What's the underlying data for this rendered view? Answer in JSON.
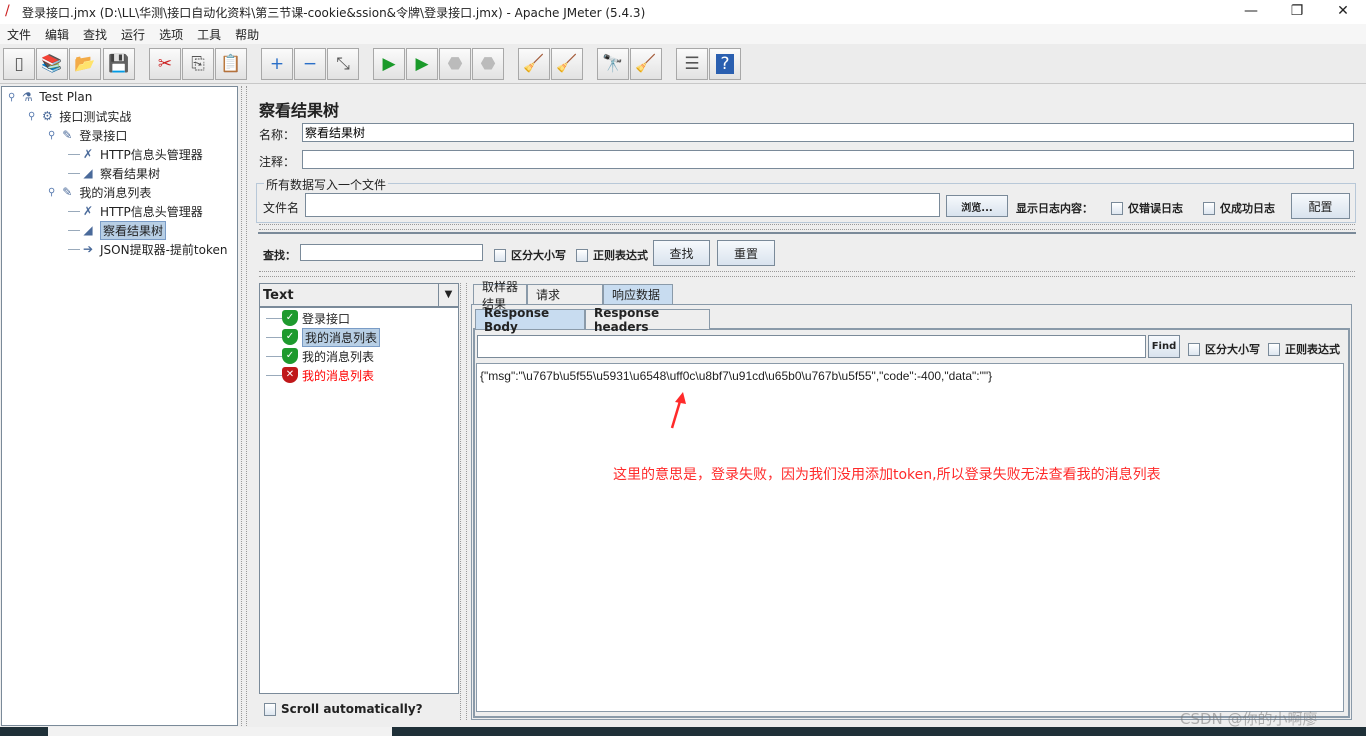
{
  "window": {
    "title": "登录接口.jmx (D:\\LL\\华测\\接口自动化资料\\第三节课-cookie&ssion&令牌\\登录接口.jmx) - Apache JMeter (5.4.3)",
    "minimize": "—",
    "maximize": "❐",
    "close": "✕"
  },
  "menu": [
    "文件",
    "编辑",
    "查找",
    "运行",
    "选项",
    "工具",
    "帮助"
  ],
  "toolbar": [
    {
      "icon": "new-icon",
      "g": "▯"
    },
    {
      "icon": "templates-icon",
      "g": "📚"
    },
    {
      "icon": "open-icon",
      "g": "📂"
    },
    {
      "icon": "save-icon",
      "g": "💾"
    },
    {
      "icon": "cut-icon",
      "g": "✂"
    },
    {
      "icon": "copy-icon",
      "g": "⎘"
    },
    {
      "icon": "paste-icon",
      "g": "📋"
    },
    {
      "icon": "expand-icon",
      "g": "+"
    },
    {
      "icon": "collapse-icon",
      "g": "−"
    },
    {
      "icon": "toggle-icon",
      "g": "⤡"
    },
    {
      "icon": "start-icon",
      "g": "▶"
    },
    {
      "icon": "start-no-pause-icon",
      "g": "▶"
    },
    {
      "icon": "stop-icon",
      "g": "⬣"
    },
    {
      "icon": "shutdown-icon",
      "g": "⬣"
    },
    {
      "icon": "clear-icon",
      "g": "🧹"
    },
    {
      "icon": "clear-all-icon",
      "g": "🧹"
    },
    {
      "icon": "search-icon",
      "g": "🔭"
    },
    {
      "icon": "reset-search-icon",
      "g": "🧹"
    },
    {
      "icon": "function-helper-icon",
      "g": "☰"
    },
    {
      "icon": "help-icon",
      "g": "?"
    }
  ],
  "tree": [
    {
      "label": "Test Plan",
      "icon": "test-plan-icon",
      "g": "⚗",
      "level": 0
    },
    {
      "label": "接口测试实战",
      "icon": "thread-group-icon",
      "g": "⚙",
      "level": 1
    },
    {
      "label": "登录接口",
      "icon": "sampler-icon",
      "g": "✎",
      "level": 2
    },
    {
      "label": "HTTP信息头管理器",
      "icon": "config-icon",
      "g": "✗",
      "level": 3
    },
    {
      "label": "察看结果树",
      "icon": "listener-icon",
      "g": "◢",
      "level": 3
    },
    {
      "label": "我的消息列表",
      "icon": "sampler-icon",
      "g": "✎",
      "level": 2
    },
    {
      "label": "HTTP信息头管理器",
      "icon": "config-icon",
      "g": "✗",
      "level": 3
    },
    {
      "label": "察看结果树",
      "icon": "listener-icon",
      "g": "◢",
      "level": 3,
      "selected": true
    },
    {
      "label": "JSON提取器-提前token",
      "icon": "extractor-icon",
      "g": "➔",
      "level": 3
    }
  ],
  "main": {
    "title": "察看结果树",
    "name_label": "名称：",
    "name_value": "察看结果树",
    "comment_label": "注释：",
    "comment_value": "",
    "file_group": "所有数据写入一个文件",
    "file_label": "文件名",
    "file_value": "",
    "browse": "浏览...",
    "log_label": "显示日志内容：",
    "errors_only": "仅错误日志",
    "success_only": "仅成功日志",
    "configure": "配置",
    "search_label": "查找：",
    "search_value": "",
    "case_sensitive": "区分大小写",
    "regex": "正则表达式",
    "search_btn": "查找",
    "reset_btn": "重置"
  },
  "results": {
    "renderer": "Text",
    "items": [
      {
        "label": "登录接口",
        "status": "success"
      },
      {
        "label": "我的消息列表",
        "status": "success",
        "selected": true
      },
      {
        "label": "我的消息列表",
        "status": "success"
      },
      {
        "label": "我的消息列表",
        "status": "error"
      }
    ],
    "scroll_auto": "Scroll automatically?",
    "tabs": [
      "取样器结果",
      "请求",
      "响应数据"
    ],
    "subtabs": [
      "Response Body",
      "Response headers"
    ],
    "find_btn": "Find",
    "find_case": "区分大小写",
    "find_regex": "正则表达式",
    "body": "{\"msg\":\"\\u767b\\u5f55\\u5931\\u6548\\uff0c\\u8bf7\\u91cd\\u65b0\\u767b\\u5f55\",\"code\":-400,\"data\":\"\"}"
  },
  "annotation": "这里的意思是，登录失败，因为我们没用添加token,所以登录失败无法查看我的消息列表",
  "watermark": "CSDN @你的小啊廖",
  "colors": {
    "accent": "#c8dcf0",
    "error": "#ff0000",
    "annotation": "#ff2a2a"
  }
}
